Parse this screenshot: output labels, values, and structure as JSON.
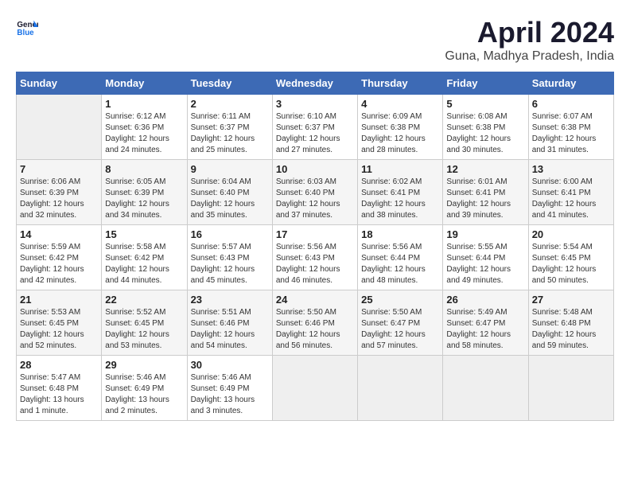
{
  "header": {
    "logo_line1": "General",
    "logo_line2": "Blue",
    "month": "April 2024",
    "location": "Guna, Madhya Pradesh, India"
  },
  "weekdays": [
    "Sunday",
    "Monday",
    "Tuesday",
    "Wednesday",
    "Thursday",
    "Friday",
    "Saturday"
  ],
  "weeks": [
    [
      {
        "day": "",
        "empty": true
      },
      {
        "day": "1",
        "rise": "6:12 AM",
        "set": "6:36 PM",
        "daylight": "12 hours and 24 minutes."
      },
      {
        "day": "2",
        "rise": "6:11 AM",
        "set": "6:37 PM",
        "daylight": "12 hours and 25 minutes."
      },
      {
        "day": "3",
        "rise": "6:10 AM",
        "set": "6:37 PM",
        "daylight": "12 hours and 27 minutes."
      },
      {
        "day": "4",
        "rise": "6:09 AM",
        "set": "6:38 PM",
        "daylight": "12 hours and 28 minutes."
      },
      {
        "day": "5",
        "rise": "6:08 AM",
        "set": "6:38 PM",
        "daylight": "12 hours and 30 minutes."
      },
      {
        "day": "6",
        "rise": "6:07 AM",
        "set": "6:38 PM",
        "daylight": "12 hours and 31 minutes."
      }
    ],
    [
      {
        "day": "7",
        "rise": "6:06 AM",
        "set": "6:39 PM",
        "daylight": "12 hours and 32 minutes."
      },
      {
        "day": "8",
        "rise": "6:05 AM",
        "set": "6:39 PM",
        "daylight": "12 hours and 34 minutes."
      },
      {
        "day": "9",
        "rise": "6:04 AM",
        "set": "6:40 PM",
        "daylight": "12 hours and 35 minutes."
      },
      {
        "day": "10",
        "rise": "6:03 AM",
        "set": "6:40 PM",
        "daylight": "12 hours and 37 minutes."
      },
      {
        "day": "11",
        "rise": "6:02 AM",
        "set": "6:41 PM",
        "daylight": "12 hours and 38 minutes."
      },
      {
        "day": "12",
        "rise": "6:01 AM",
        "set": "6:41 PM",
        "daylight": "12 hours and 39 minutes."
      },
      {
        "day": "13",
        "rise": "6:00 AM",
        "set": "6:41 PM",
        "daylight": "12 hours and 41 minutes."
      }
    ],
    [
      {
        "day": "14",
        "rise": "5:59 AM",
        "set": "6:42 PM",
        "daylight": "12 hours and 42 minutes."
      },
      {
        "day": "15",
        "rise": "5:58 AM",
        "set": "6:42 PM",
        "daylight": "12 hours and 44 minutes."
      },
      {
        "day": "16",
        "rise": "5:57 AM",
        "set": "6:43 PM",
        "daylight": "12 hours and 45 minutes."
      },
      {
        "day": "17",
        "rise": "5:56 AM",
        "set": "6:43 PM",
        "daylight": "12 hours and 46 minutes."
      },
      {
        "day": "18",
        "rise": "5:56 AM",
        "set": "6:44 PM",
        "daylight": "12 hours and 48 minutes."
      },
      {
        "day": "19",
        "rise": "5:55 AM",
        "set": "6:44 PM",
        "daylight": "12 hours and 49 minutes."
      },
      {
        "day": "20",
        "rise": "5:54 AM",
        "set": "6:45 PM",
        "daylight": "12 hours and 50 minutes."
      }
    ],
    [
      {
        "day": "21",
        "rise": "5:53 AM",
        "set": "6:45 PM",
        "daylight": "12 hours and 52 minutes."
      },
      {
        "day": "22",
        "rise": "5:52 AM",
        "set": "6:45 PM",
        "daylight": "12 hours and 53 minutes."
      },
      {
        "day": "23",
        "rise": "5:51 AM",
        "set": "6:46 PM",
        "daylight": "12 hours and 54 minutes."
      },
      {
        "day": "24",
        "rise": "5:50 AM",
        "set": "6:46 PM",
        "daylight": "12 hours and 56 minutes."
      },
      {
        "day": "25",
        "rise": "5:50 AM",
        "set": "6:47 PM",
        "daylight": "12 hours and 57 minutes."
      },
      {
        "day": "26",
        "rise": "5:49 AM",
        "set": "6:47 PM",
        "daylight": "12 hours and 58 minutes."
      },
      {
        "day": "27",
        "rise": "5:48 AM",
        "set": "6:48 PM",
        "daylight": "12 hours and 59 minutes."
      }
    ],
    [
      {
        "day": "28",
        "rise": "5:47 AM",
        "set": "6:48 PM",
        "daylight": "13 hours and 1 minute."
      },
      {
        "day": "29",
        "rise": "5:46 AM",
        "set": "6:49 PM",
        "daylight": "13 hours and 2 minutes."
      },
      {
        "day": "30",
        "rise": "5:46 AM",
        "set": "6:49 PM",
        "daylight": "13 hours and 3 minutes."
      },
      {
        "day": "",
        "empty": true
      },
      {
        "day": "",
        "empty": true
      },
      {
        "day": "",
        "empty": true
      },
      {
        "day": "",
        "empty": true
      }
    ]
  ]
}
